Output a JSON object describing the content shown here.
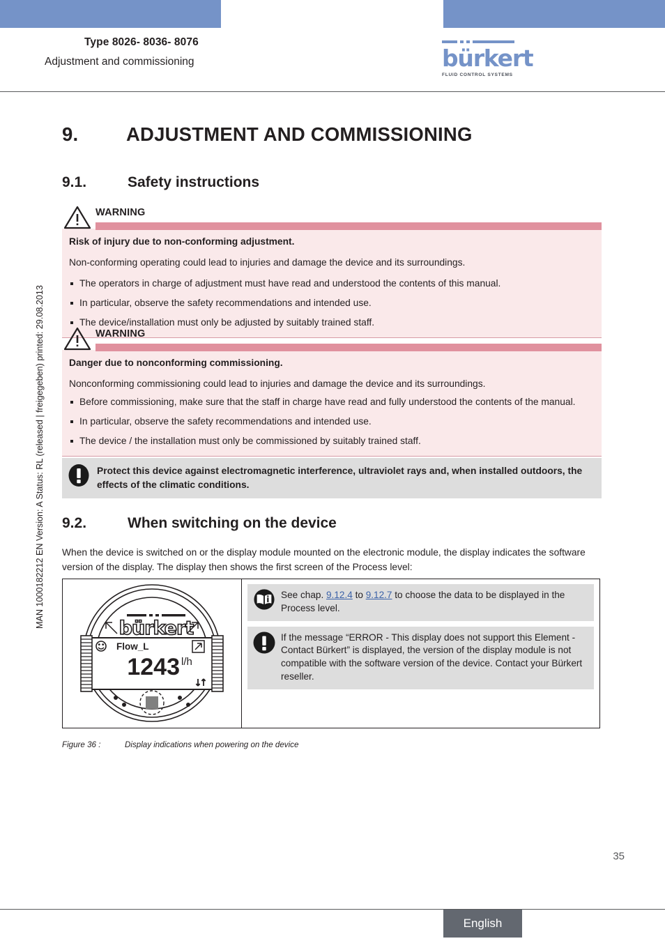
{
  "header": {
    "type_line": "Type 8026- 8036- 8076",
    "subtitle": "Adjustment and commissioning",
    "logo_word": "bürkert",
    "logo_tagline": "FLUID CONTROL SYSTEMS"
  },
  "sidenote": "MAN 1000182212  EN  Version: A  Status: RL (released | freigegeben)  printed: 29.08.2013",
  "headings": {
    "h1_number": "9.",
    "h1_text": "ADJUSTMENT AND COMMISSIONING",
    "h2_number": "9.1.",
    "h2_text": "Safety instructions",
    "h2b_number": "9.2.",
    "h2b_text": "When switching on the device"
  },
  "warnings": [
    {
      "title": "WARNING",
      "lead": "Risk of injury due to non-conforming adjustment.",
      "paragraph": "Non-conforming operating could lead to injuries and damage the device and its surroundings.",
      "bullets": [
        "The operators in charge of adjustment must have read and understood the contents of this manual.",
        "In particular, observe the safety recommendations and intended use.",
        "The device/installation must only be adjusted by suitably trained staff."
      ]
    },
    {
      "title": "WARNING",
      "lead": "Danger due to nonconforming commissioning.",
      "paragraph": "Nonconforming commissioning could lead to injuries and damage the device and its surroundings.",
      "bullets": [
        "Before commissioning, make sure that the staff in charge have read and fully understood the contents of the manual.",
        "In particular, observe the safety recommendations and intended use.",
        "The device / the installation must only be commissioned by suitably trained staff."
      ]
    }
  ],
  "note": {
    "text": "Protect this device against electromagnetic interference, ultraviolet rays and, when installed outdoors, the effects of the climatic conditions."
  },
  "section_92": {
    "paragraph": "When the device is switched on or the display module mounted on the electronic module, the display indicates the software version of the display. The display then shows the first screen of the Process level:"
  },
  "figure": {
    "device": {
      "brand": "bürkert",
      "channel_label": "Flow_L",
      "value": "1243",
      "unit": "l/h"
    },
    "notes": [
      {
        "icon": "book-info-icon",
        "prefix": "See chap. ",
        "xref1": "9.12.4",
        "middle": " to ",
        "xref2": "9.12.7",
        "suffix": " to choose the data to be displayed in the Process level."
      },
      {
        "icon": "exclamation-icon",
        "text": "If the message “ERROR - This display does not support this Element - Contact Bürkert” is displayed, the version of the display module is not compatible with the software version of the device. Contact your Bürkert reseller."
      }
    ],
    "caption_label": "Figure 36 :",
    "caption_text": "Display indications when powering on the device"
  },
  "footer": {
    "page_number": "35",
    "language": "English"
  },
  "colors": {
    "brand_blue": "#7593c8",
    "warning_bar": "#e0919e",
    "warning_bg": "#fae9ea",
    "note_bg": "#dddddd",
    "footer_bg": "#636870",
    "xref": "#3b62a8"
  }
}
